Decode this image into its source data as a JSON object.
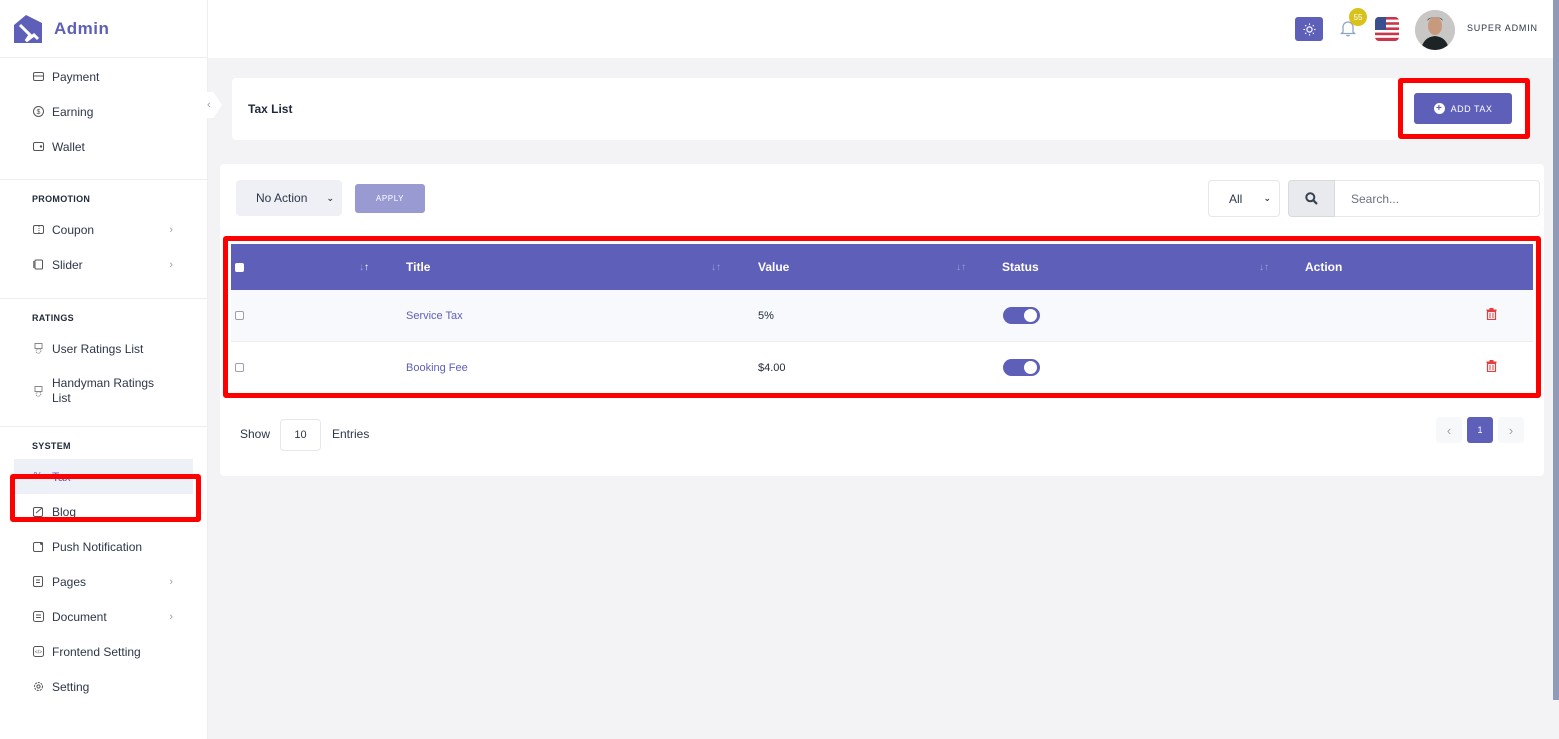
{
  "brand": {
    "name": "Admin"
  },
  "sidebar": {
    "top_items": [
      {
        "label": "Payment",
        "icon": "credit-card-icon"
      },
      {
        "label": "Earning",
        "icon": "dollar-circle-icon"
      },
      {
        "label": "Wallet",
        "icon": "wallet-icon"
      }
    ],
    "sections": [
      {
        "title": "PROMOTION",
        "items": [
          {
            "label": "Coupon",
            "icon": "coupon-icon",
            "has_submenu": true
          },
          {
            "label": "Slider",
            "icon": "slider-icon",
            "has_submenu": true
          }
        ]
      },
      {
        "title": "RATINGS",
        "items": [
          {
            "label": "User Ratings List",
            "icon": "award-icon"
          },
          {
            "label": "Handyman Ratings List",
            "icon": "award-icon"
          }
        ]
      },
      {
        "title": "SYSTEM",
        "items": [
          {
            "label": "Tax",
            "icon": "percent-icon",
            "active": true
          },
          {
            "label": "Blog",
            "icon": "blog-icon"
          },
          {
            "label": "Push Notification",
            "icon": "notification-icon"
          },
          {
            "label": "Pages",
            "icon": "pages-icon",
            "has_submenu": true
          },
          {
            "label": "Document",
            "icon": "document-icon",
            "has_submenu": true
          },
          {
            "label": "Frontend Setting",
            "icon": "code-icon"
          },
          {
            "label": "Setting",
            "icon": "gear-icon"
          }
        ]
      }
    ]
  },
  "topbar": {
    "notification_count": "55",
    "user_name": "SUPER ADMIN"
  },
  "page": {
    "title": "Tax List",
    "add_button": "ADD TAX"
  },
  "toolbar": {
    "bulk_action": "No Action",
    "apply": "APPLY",
    "filter": "All",
    "search_placeholder": "Search..."
  },
  "table": {
    "columns": [
      "Title",
      "Value",
      "Status",
      "Action"
    ],
    "rows": [
      {
        "title": "Service Tax",
        "value": "5%",
        "status": true
      },
      {
        "title": "Booking Fee",
        "value": "$4.00",
        "status": true
      }
    ]
  },
  "footer": {
    "show_label": "Show",
    "page_size": "10",
    "entries_label": "Entries",
    "current_page": "1"
  },
  "colors": {
    "primary": "#5e5fb8",
    "danger": "#e53e3e",
    "highlight": "#ff0000",
    "badge": "#d9c21a"
  }
}
